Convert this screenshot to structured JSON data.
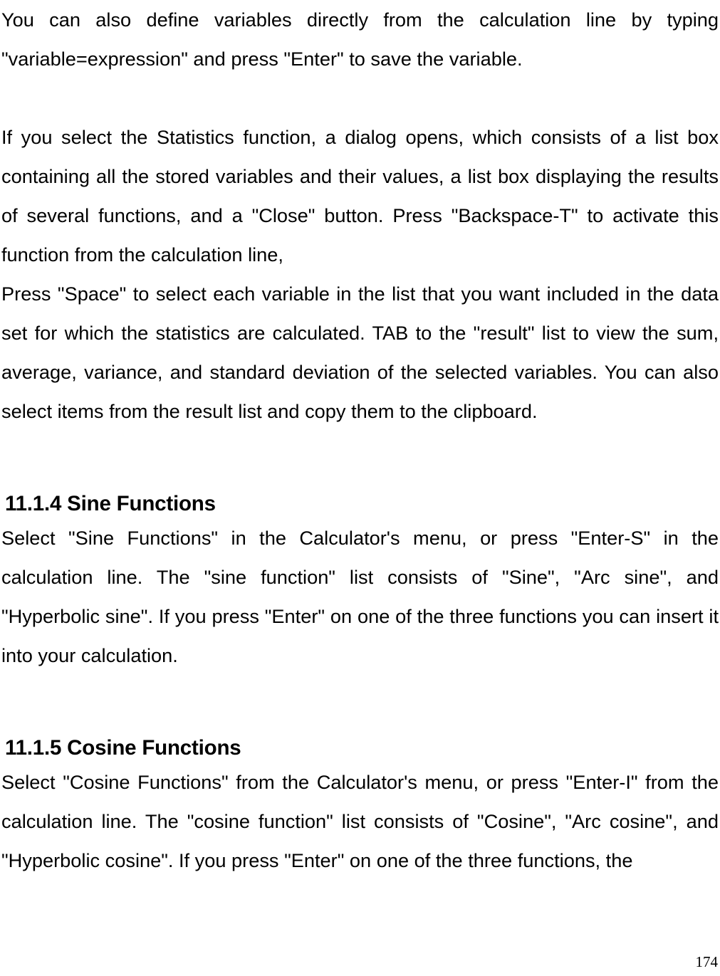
{
  "document": {
    "page_number": "174",
    "paragraphs": [
      {
        "id": "p-variables",
        "text": "You can also define variables directly from the calculation line by typing \"variable=expression\" and press \"Enter\" to save the variable."
      },
      {
        "id": "p-statistics",
        "text": "If you select the Statistics function, a dialog opens, which consists of a list box containing all the stored variables and their values, a list box displaying the results of several functions, and a \"Close\" button. Press \"Backspace-T\" to activate this function from the calculation line,"
      },
      {
        "id": "p-space-select",
        "text": "Press \"Space\" to select each variable in the list that you want included in the data set for which the statistics are calculated. TAB to the \"result\" list to view the sum, average, variance, and standard deviation of the selected variables. You can also select items from the result list and copy them to the clipboard."
      }
    ],
    "sections": [
      {
        "id": "sec-sine",
        "number": "11.1.4",
        "title": "11.1.4 Sine Functions",
        "body": "Select \"Sine Functions\" in the Calculator's menu, or press \"Enter-S\" in the calculation line. The \"sine function\" list consists of \"Sine\", \"Arc sine\", and \"Hyperbolic sine\". If you press \"Enter\" on one of the three functions you can insert it into your calculation."
      },
      {
        "id": "sec-cosine",
        "number": "11.1.5",
        "title": "11.1.5 Cosine Functions",
        "body": "Select \"Cosine Functions\" from the Calculator's menu, or press \"Enter-I\" from the calculation line. The \"cosine function\" list consists of \"Cosine\", \"Arc cosine\", and \"Hyperbolic cosine\". If you press \"Enter\" on one of the three functions, the"
      }
    ]
  }
}
